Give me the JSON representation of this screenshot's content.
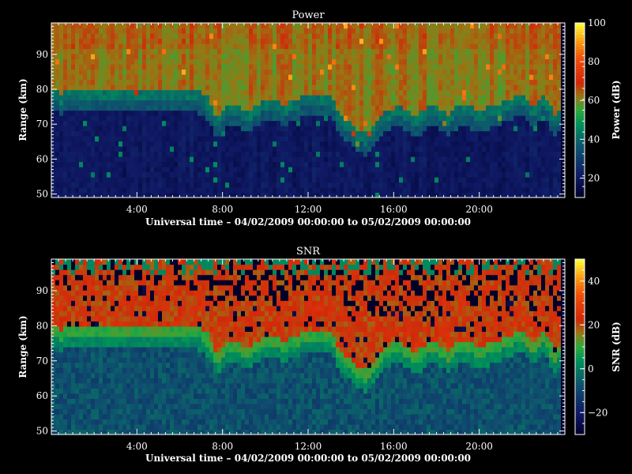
{
  "chart_data": [
    {
      "type": "heatmap",
      "title": "Power",
      "xlabel": "Universal time – 04/02/2009 00:00:00 to 05/02/2009 00:00:00",
      "ylabel": "Range (km)",
      "xlim": [
        0,
        24
      ],
      "ylim": [
        49,
        99
      ],
      "x_ticks": [
        4,
        8,
        12,
        16,
        20
      ],
      "x_tick_labels": [
        "4:00",
        "8:00",
        "12:00",
        "16:00",
        "20:00"
      ],
      "y_ticks": [
        50,
        60,
        70,
        80,
        90
      ],
      "y_tick_labels": [
        "50",
        "60",
        "70",
        "80",
        "90"
      ],
      "colorbar": {
        "label": "Power (dB)",
        "range": [
          10,
          100
        ],
        "ticks": [
          20,
          40,
          60,
          80,
          100
        ],
        "tick_labels": [
          "20",
          "40",
          "60",
          "80",
          "100"
        ]
      },
      "boundary_km_by_hour": [
        {
          "t": 0.0,
          "km": 77
        },
        {
          "t": 0.5,
          "km": 76
        },
        {
          "t": 1.0,
          "km": 77
        },
        {
          "t": 3.0,
          "km": 77
        },
        {
          "t": 6.0,
          "km": 77
        },
        {
          "t": 7.2,
          "km": 76
        },
        {
          "t": 7.7,
          "km": 69
        },
        {
          "t": 8.3,
          "km": 73
        },
        {
          "t": 9.3,
          "km": 71
        },
        {
          "t": 10.0,
          "km": 74
        },
        {
          "t": 11.0,
          "km": 73
        },
        {
          "t": 12.0,
          "km": 76
        },
        {
          "t": 13.0,
          "km": 76
        },
        {
          "t": 13.5,
          "km": 70
        },
        {
          "t": 14.2,
          "km": 66
        },
        {
          "t": 14.8,
          "km": 64
        },
        {
          "t": 15.5,
          "km": 70
        },
        {
          "t": 16.2,
          "km": 73
        },
        {
          "t": 17.0,
          "km": 69
        },
        {
          "t": 17.8,
          "km": 73
        },
        {
          "t": 18.5,
          "km": 70
        },
        {
          "t": 19.2,
          "km": 73
        },
        {
          "t": 20.0,
          "km": 71
        },
        {
          "t": 21.0,
          "km": 73
        },
        {
          "t": 22.0,
          "km": 76
        },
        {
          "t": 22.5,
          "km": 72
        },
        {
          "t": 23.0,
          "km": 76
        },
        {
          "t": 23.5,
          "km": 70
        },
        {
          "t": 24.0,
          "km": 73
        }
      ],
      "typical_levels": {
        "upper_db": 62,
        "lower_db": 20
      },
      "blank_interval": [
        23.8,
        24.0
      ]
    },
    {
      "type": "heatmap",
      "title": "SNR",
      "xlabel": "Universal time – 04/02/2009 00:00:00 to 05/02/2009 00:00:00",
      "ylabel": "Range (km)",
      "xlim": [
        0,
        24
      ],
      "ylim": [
        49,
        99
      ],
      "x_ticks": [
        4,
        8,
        12,
        16,
        20
      ],
      "x_tick_labels": [
        "4:00",
        "8:00",
        "12:00",
        "16:00",
        "20:00"
      ],
      "y_ticks": [
        50,
        60,
        70,
        80,
        90
      ],
      "y_tick_labels": [
        "50",
        "60",
        "70",
        "80",
        "90"
      ],
      "colorbar": {
        "label": "SNR (dB)",
        "range": [
          -30,
          50
        ],
        "ticks": [
          -20,
          0,
          20,
          40
        ],
        "tick_labels": [
          "−20",
          "0",
          "20",
          "40"
        ]
      },
      "typical_levels": {
        "upper_db": 22,
        "lower_db": -8
      },
      "blank_interval": [
        23.8,
        24.0
      ]
    }
  ]
}
